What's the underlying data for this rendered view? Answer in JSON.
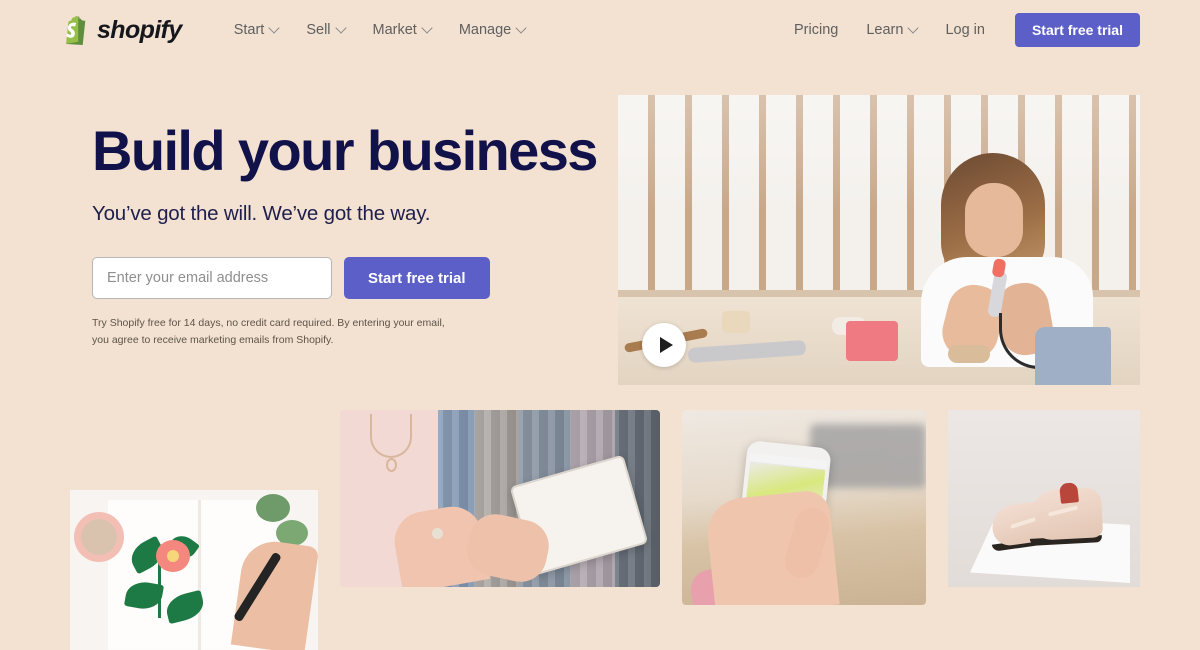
{
  "nav": {
    "logo": {
      "icon": "shopify-bag-icon",
      "wordmark": "shopify"
    },
    "left_links": [
      {
        "label": "Start",
        "caret": true
      },
      {
        "label": "Sell",
        "caret": true
      },
      {
        "label": "Market",
        "caret": true
      },
      {
        "label": "Manage",
        "caret": true
      }
    ],
    "right_links": [
      {
        "label": "Pricing",
        "caret": false
      },
      {
        "label": "Learn",
        "caret": true
      },
      {
        "label": "Log in",
        "caret": false
      }
    ],
    "cta_label": "Start free trial"
  },
  "hero": {
    "title": "Build your business",
    "subtitle": "You’ve got the will. We’ve got the way.",
    "email_placeholder": "Enter your email address",
    "email_value": "",
    "cta_label": "Start free trial",
    "disclaimer": "Try Shopify free for 14 days, no credit card required. By entering your email, you agree to receive marketing emails from Shopify."
  },
  "video": {
    "name": "hero-video-thumbnail",
    "description": "Woman working at a craft table with a wooden slat wall behind her",
    "play_icon": "play-icon"
  },
  "gallery": [
    {
      "name": "gallery-card-sketch",
      "description": "Hand painting a pink flower in a sketchbook beside a cup and eucalyptus"
    },
    {
      "name": "gallery-card-clothing-rack",
      "description": "Hands holding a tablet in front of a rack of clothing"
    },
    {
      "name": "gallery-card-phone",
      "description": "Hand holding a smartphone showing an online store collection page"
    },
    {
      "name": "gallery-card-shoes",
      "description": "Pair of blush leather brogue shoes on a white pedestal"
    }
  ],
  "colors": {
    "background": "#f3e2d2",
    "accent": "#5c5fc8",
    "heading": "#12124a",
    "nav_link": "#5f5f5f",
    "logo_green": "#95bf47"
  }
}
